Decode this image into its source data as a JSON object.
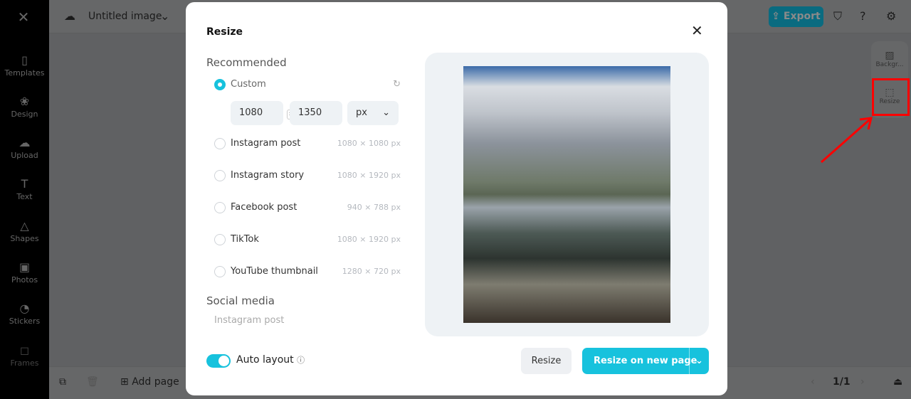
{
  "app": {
    "title": "Untitled image",
    "export": "Export"
  },
  "sidebar": {
    "items": [
      {
        "label": "Templates"
      },
      {
        "label": "Design"
      },
      {
        "label": "Upload"
      },
      {
        "label": "Text"
      },
      {
        "label": "Shapes"
      },
      {
        "label": "Photos"
      },
      {
        "label": "Stickers"
      },
      {
        "label": "Frames"
      }
    ]
  },
  "right_panel": {
    "background": "Backgr...",
    "resize": "Resize"
  },
  "bottom": {
    "add_page": "Add page",
    "page": "1/1"
  },
  "modal": {
    "title": "Resize",
    "recommended": "Recommended",
    "custom": {
      "label": "Custom",
      "width": "1080",
      "height": "1350",
      "unit": "px"
    },
    "options": [
      {
        "label": "Instagram post",
        "size": "1080 × 1080 px"
      },
      {
        "label": "Instagram story",
        "size": "1080 × 1920 px"
      },
      {
        "label": "Facebook post",
        "size": "940 × 788 px"
      },
      {
        "label": "TikTok",
        "size": "1080 × 1920 px"
      },
      {
        "label": "YouTube thumbnail",
        "size": "1280 × 720 px"
      }
    ],
    "social_media": "Social media",
    "social_first": "Instagram post",
    "auto_layout": "Auto layout",
    "auto_layout_on": true,
    "resize": "Resize",
    "resize_new": "Resize on new page"
  },
  "colors": {
    "accent": "#17c2dd",
    "highlight": "#ff0000"
  }
}
